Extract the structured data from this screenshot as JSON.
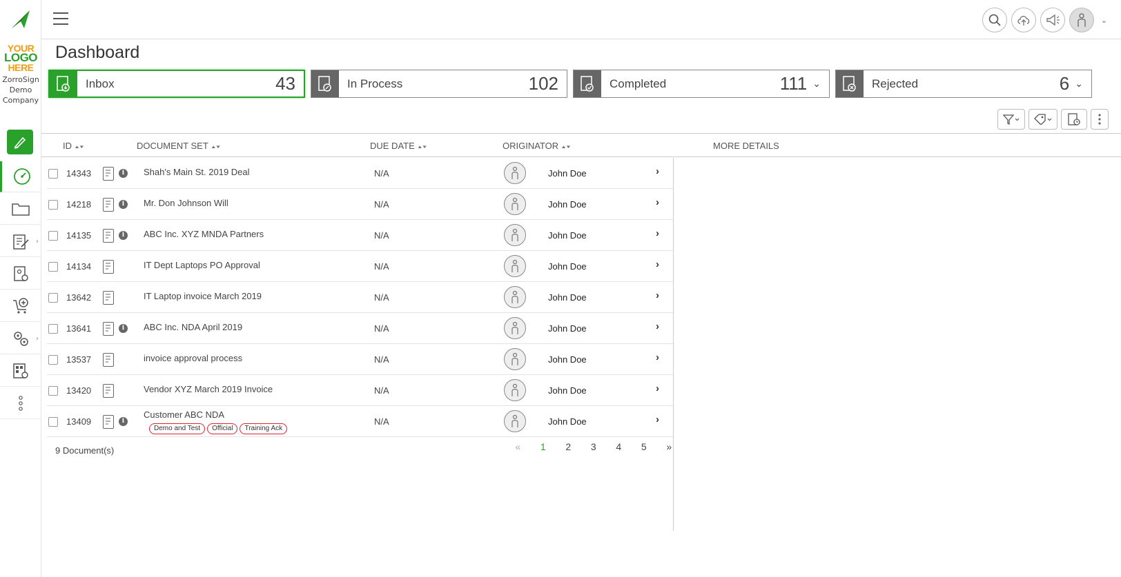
{
  "sidebar": {
    "logo_text": [
      "YOUR",
      "LOGO",
      "HERE"
    ],
    "company_name": "ZorroSign Demo Company",
    "items": [
      {
        "icon": "sign-pen-icon"
      },
      {
        "icon": "dashboard-icon"
      },
      {
        "icon": "folder-icon"
      },
      {
        "icon": "edit-document-icon"
      },
      {
        "icon": "document-settings-icon"
      },
      {
        "icon": "cart-add-icon"
      },
      {
        "icon": "gear-people-icon"
      },
      {
        "icon": "qr-settings-icon"
      },
      {
        "icon": "more-vertical-icon"
      }
    ]
  },
  "header": {
    "page_title": "Dashboard"
  },
  "cards": [
    {
      "label": "Inbox",
      "count": "43",
      "active": true
    },
    {
      "label": "In Process",
      "count": "102"
    },
    {
      "label": "Completed",
      "count": "111",
      "dropdown": true
    },
    {
      "label": "Rejected",
      "count": "6",
      "dropdown": true
    }
  ],
  "table": {
    "headers": {
      "id": "ID",
      "document_set": "DOCUMENT SET",
      "due_date": "DUE DATE",
      "originator": "ORIGINATOR",
      "more_details": "MORE DETAILS"
    },
    "rows": [
      {
        "id": "14343",
        "name": "Shah's Main St. 2019 Deal",
        "due": "N/A",
        "originator": "John Doe",
        "info": true
      },
      {
        "id": "14218",
        "name": "Mr. Don Johnson Will",
        "due": "N/A",
        "originator": "John Doe",
        "info": true
      },
      {
        "id": "14135",
        "name": "ABC Inc. XYZ MNDA Partners",
        "due": "N/A",
        "originator": "John Doe",
        "info": true
      },
      {
        "id": "14134",
        "name": "IT Dept Laptops PO Approval",
        "due": "N/A",
        "originator": "John Doe",
        "info": false
      },
      {
        "id": "13642",
        "name": "IT Laptop invoice March 2019",
        "due": "N/A",
        "originator": "John Doe",
        "info": false
      },
      {
        "id": "13641",
        "name": "ABC Inc. NDA April 2019",
        "due": "N/A",
        "originator": "John Doe",
        "info": true
      },
      {
        "id": "13537",
        "name": "invoice approval process",
        "due": "N/A",
        "originator": "John Doe",
        "info": false
      },
      {
        "id": "13420",
        "name": "Vendor XYZ March 2019 Invoice",
        "due": "N/A",
        "originator": "John Doe",
        "info": false
      },
      {
        "id": "13409",
        "name": "Customer ABC NDA",
        "due": "N/A",
        "originator": "John Doe",
        "info": true,
        "tags": [
          "Demo and Test",
          "Official",
          "Training Ack"
        ]
      }
    ],
    "footer_count": "9 Document(s)"
  },
  "pagination": {
    "prev": "«",
    "pages": [
      "1",
      "2",
      "3",
      "4",
      "5"
    ],
    "current": "1",
    "next": "»"
  }
}
